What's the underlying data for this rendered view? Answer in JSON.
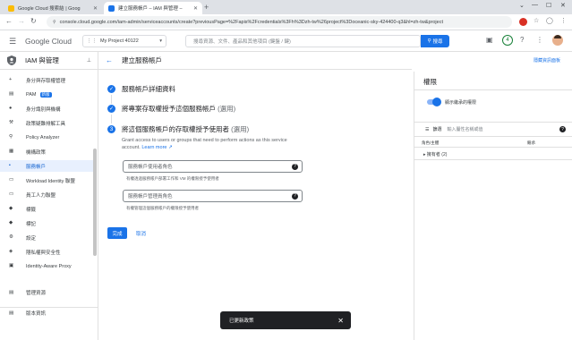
{
  "browser": {
    "tabs": [
      {
        "label": "Google Cloud 搜索結 | Goog",
        "active": false,
        "favicon_color": "#fbbc04"
      },
      {
        "label": "建立服務帳戶 – IAM 與管理 –",
        "active": true,
        "favicon_color": "#1a73e8"
      }
    ],
    "new_tab": "+",
    "url": "console.cloud.google.com/iam-admin/serviceaccounts/create?previousPage=%2Fapis%2Fcredentials%3Fh%3Dzh-tw%26project%3Doceanic-sky-424400-q3&hl=zh-tw&project"
  },
  "header": {
    "logo": "Google Cloud",
    "project": "My Project 40122",
    "search_placeholder": "搜尋資源、文件、產品和其他項目 (鍵盤 / 鍵)",
    "search_button": "搜尋",
    "notification_count": "4"
  },
  "sidebar": {
    "title": "IAM 與管理",
    "items": [
      {
        "label": "身分與存取權管理",
        "icon": "person-add-icon"
      },
      {
        "label": "PAM",
        "badge": "新版",
        "icon": "pam-icon"
      },
      {
        "label": "身分識別與機構",
        "icon": "account-circle-icon"
      },
      {
        "label": "政策疑難排解工具",
        "icon": "wrench-icon"
      },
      {
        "label": "Policy Analyzer",
        "icon": "search-doc-icon"
      },
      {
        "label": "機構政策",
        "icon": "list-icon"
      },
      {
        "label": "服務帳戶",
        "icon": "service-account-icon",
        "active": true
      },
      {
        "label": "Workload Identity 聯盟",
        "icon": "workload-icon"
      },
      {
        "label": "員工人力聯盟",
        "icon": "people-icon"
      },
      {
        "label": "標籤",
        "icon": "label-icon"
      },
      {
        "label": "標記",
        "icon": "tag-icon"
      },
      {
        "label": "設定",
        "icon": "gear-icon"
      },
      {
        "label": "隱私權與安全性",
        "icon": "shield-icon"
      },
      {
        "label": "Identity-Aware Proxy",
        "icon": "iap-icon"
      }
    ],
    "bottom_items": [
      {
        "label": "管理資源",
        "icon": "folder-icon"
      },
      {
        "label": "版本資訊",
        "icon": "release-notes-icon"
      }
    ]
  },
  "main": {
    "title": "建立服務帳戶",
    "help_link": "隱藏資訊面板",
    "steps": [
      {
        "number": "✓",
        "label": "服務帳戶詳細資料",
        "optional": ""
      },
      {
        "number": "✓",
        "label": "將專案存取權授予這個服務帳戶",
        "optional": "(選用)"
      },
      {
        "number": "3",
        "label": "將這個服務帳戶的存取權授予使用者",
        "optional": "(選用)"
      }
    ],
    "description": "Grant access to users or groups that need to perform actions as this service account.",
    "learn_more": "Learn more",
    "fields": [
      {
        "placeholder": "服務帳戶使用者角色",
        "hint": "有權透過服務帳戶部署工作和 VM 的權限授予使用者"
      },
      {
        "placeholder": "服務帳戶管理員角色",
        "hint": "有權管理這個服務帳戶的權限授予使用者"
      }
    ],
    "done_button": "完成",
    "cancel_button": "取消"
  },
  "panel": {
    "title": "權限",
    "toggle_label": "顯示繼承的權限",
    "filter_label": "篩選",
    "filter_placeholder": "輸入屬性名稱或值",
    "col_role": "角色/主體",
    "col_inherit": "繼承",
    "row_owner": "擁有者 (2)"
  },
  "snackbar": {
    "message": "已更新政策"
  },
  "colors": {
    "accent": "#1a73e8",
    "active_bg": "#e8f0fe"
  }
}
